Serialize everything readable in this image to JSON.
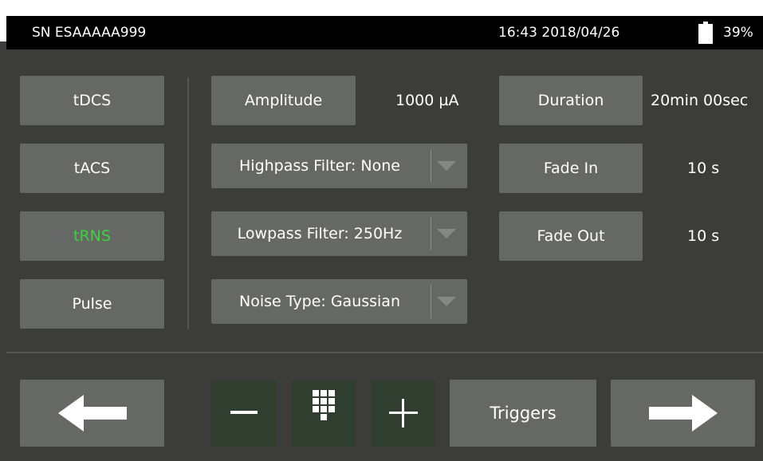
{
  "status": {
    "serial": "SN ESAAAAA999",
    "datetime": "16:43 2018/04/26",
    "battery": "39%"
  },
  "modes": [
    {
      "label": "tDCS",
      "active": false
    },
    {
      "label": "tACS",
      "active": false
    },
    {
      "label": "tRNS",
      "active": true
    },
    {
      "label": "Pulse",
      "active": false
    }
  ],
  "amplitude": {
    "label": "Amplitude",
    "value": "1000 µA"
  },
  "filters": {
    "highpass": "Highpass Filter: None",
    "lowpass": "Lowpass Filter: 250Hz",
    "noise": "Noise Type: Gaussian"
  },
  "timing": {
    "duration_label": "Duration",
    "duration_value": "20min 00sec",
    "fade_in_label": "Fade In",
    "fade_in_value": "10 s",
    "fade_out_label": "Fade Out",
    "fade_out_value": "10 s"
  },
  "bottom": {
    "triggers_label": "Triggers",
    "icons": [
      "arrow-left-icon",
      "minus-icon",
      "keypad-icon",
      "plus-icon",
      "arrow-right-icon"
    ]
  },
  "colors": {
    "active_mode": "#3fd23f",
    "button": "#666866",
    "background": "#3c3d3b"
  }
}
